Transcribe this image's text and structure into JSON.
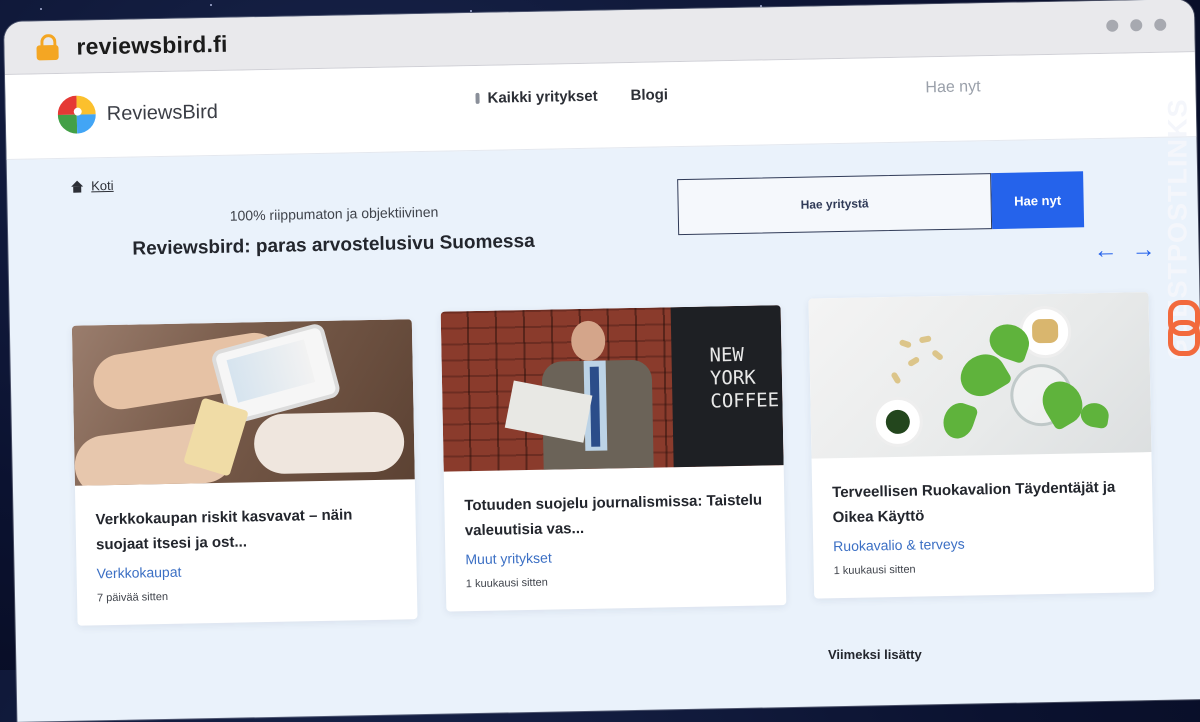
{
  "browser": {
    "url": "reviewsbird.fi"
  },
  "header": {
    "logo_text": "ReviewsBird",
    "nav": {
      "companies": "Kaikki yritykset",
      "blog": "Blogi",
      "search": "Hae nyt"
    }
  },
  "hero": {
    "breadcrumb_home": "Koti",
    "tagline": "100% riippumaton ja objektiivinen",
    "title": "Reviewsbird: paras arvostelusivu Suomessa",
    "search_placeholder": "Hae yritystä",
    "search_button": "Hae nyt",
    "arrow_prev": "←",
    "arrow_next": "→"
  },
  "cards": [
    {
      "title": "Verkkokaupan riskit kasvavat – näin suojaat itsesi ja ost...",
      "category": "Verkkokaupat",
      "date": "7 päivää sitten"
    },
    {
      "title": "Totuuden suojelu journalismissa: Taistelu valeuutisia vas...",
      "category": "Muut yritykset",
      "date": "1 kuukausi sitten",
      "image_sign": "NEW\nYORK\nCOFFEE"
    },
    {
      "title": "Terveellisen Ruokavalion Täydentäjät ja Oikea Käyttö",
      "category": "Ruokavalio & terveys",
      "date": "1 kuukausi sitten"
    }
  ],
  "below_fold_text": "Viimeksi lisätty",
  "watermark": "GUESTPOSTLINKS",
  "colors": {
    "accent": "#2563eb",
    "link": "#3b6fc4",
    "page_bg": "#eaf2fb",
    "watermark_brand": "#f26a3d"
  }
}
